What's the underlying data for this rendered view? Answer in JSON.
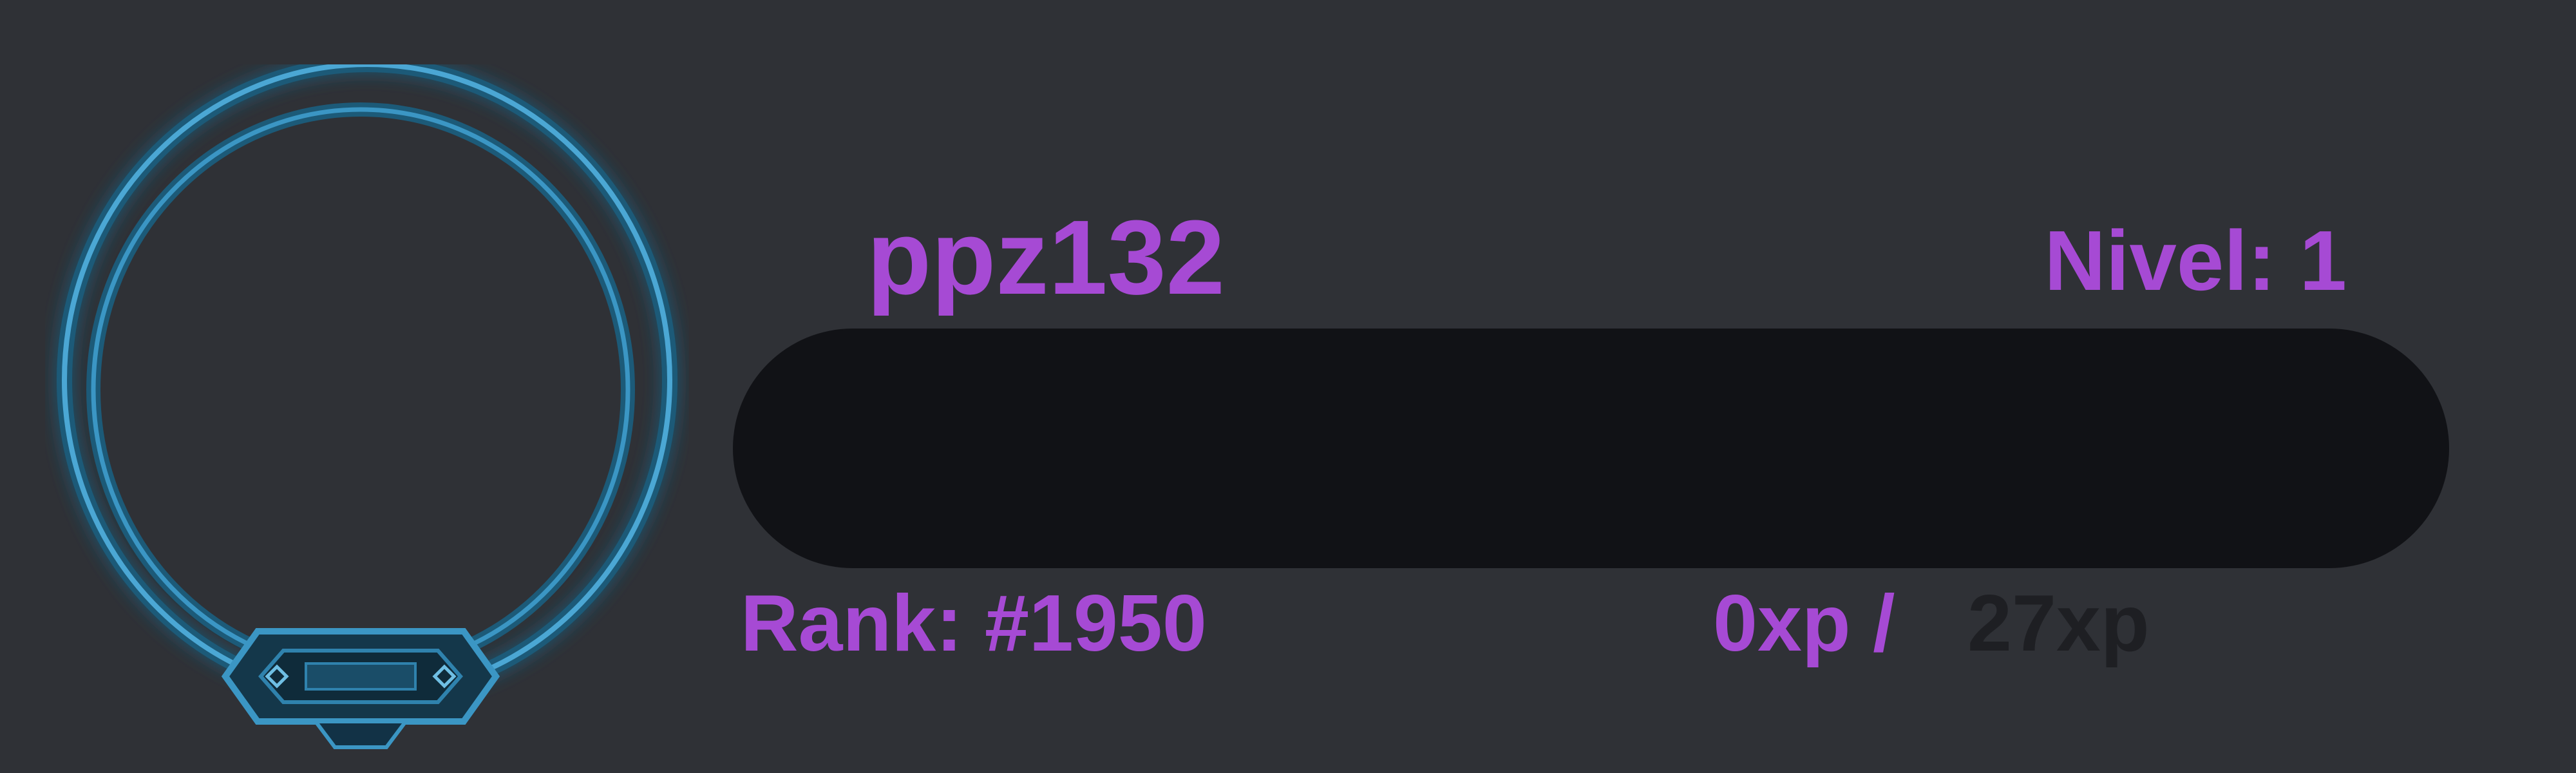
{
  "profile": {
    "username": "ppz132",
    "level_text": "Nivel: 1",
    "rank_text": "Rank: #1950",
    "xp_current_text": "0xp /",
    "xp_needed_text": "27xp",
    "xp_progress": 0
  },
  "icons": {
    "avatar_frame": "avatar-frame-icon"
  },
  "colors": {
    "background": "#2f3136",
    "accent": "#a64ad4",
    "xp_needed": "#1e1f23",
    "progress_track": "#111216",
    "progress_fill": "#a64ad4",
    "frame_blue": "#3b96c4"
  }
}
